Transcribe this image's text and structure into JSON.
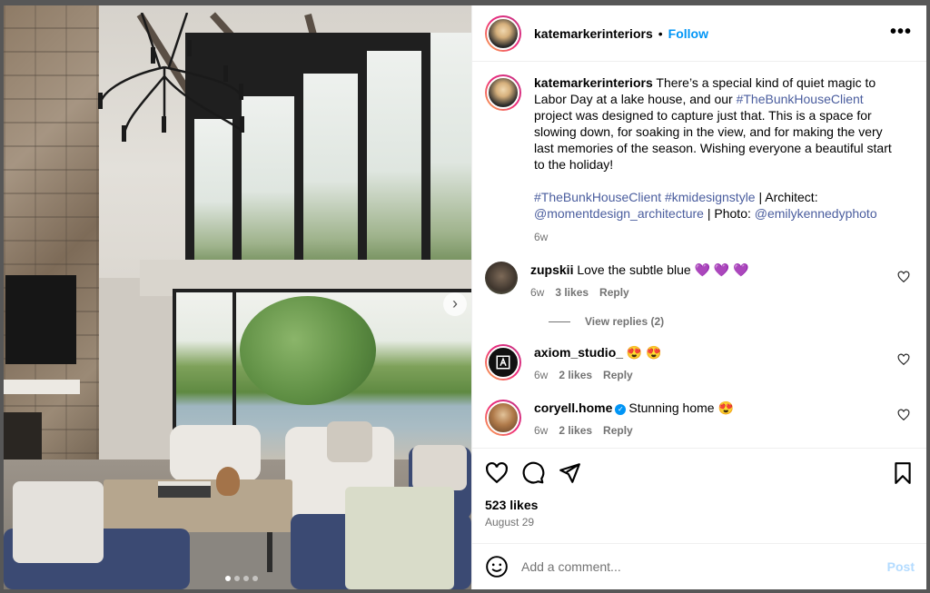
{
  "post": {
    "username": "katemarkerinteriors",
    "dot": "•",
    "follow_label": "Follow",
    "more_label": "•••",
    "next_label": "›"
  },
  "caption": {
    "username": "katemarkerinteriors",
    "text_1": " There’s a special kind of quiet magic to Labor Day at a lake house, and our ",
    "hashtag_1": "#TheBunkHouseClient",
    "text_2": " project was designed to capture just that. This is a space for slowing down, for soaking in the view, and for making the very last memories of the season. Wishing everyone a beautiful start to the holiday!",
    "hashtag_2": "#TheBunkHouseClient",
    "hashtag_3": "#kmidesignstyle",
    "text_3": " | Architect: ",
    "mention_1": "@momentdesign_architecture",
    "text_4": " | Photo: ",
    "mention_2": "@emilykennedyphoto",
    "time": "6w"
  },
  "comments": [
    {
      "username": "zupskii",
      "text": "Love the subtle blue 💜 💜 💜",
      "time": "6w",
      "likes": "3 likes",
      "reply": "Reply"
    },
    {
      "username": "axiom_studio_",
      "text": "😍 😍",
      "time": "6w",
      "likes": "2 likes",
      "reply": "Reply"
    },
    {
      "username": "coryell.home",
      "text": "Stunning home 😍",
      "time": "6w",
      "likes": "2 likes",
      "reply": "Reply",
      "verified_mark": "✓"
    }
  ],
  "view_replies": "View replies (2)",
  "likes_count": "523 likes",
  "post_date": "August 29",
  "add_comment": {
    "placeholder": "Add a comment...",
    "post_label": "Post"
  },
  "carousel": {
    "count": 4,
    "active": 1
  },
  "colors": {
    "accent": "#0095f6",
    "hashtag": "#4a5d9e",
    "muted": "#737373"
  }
}
